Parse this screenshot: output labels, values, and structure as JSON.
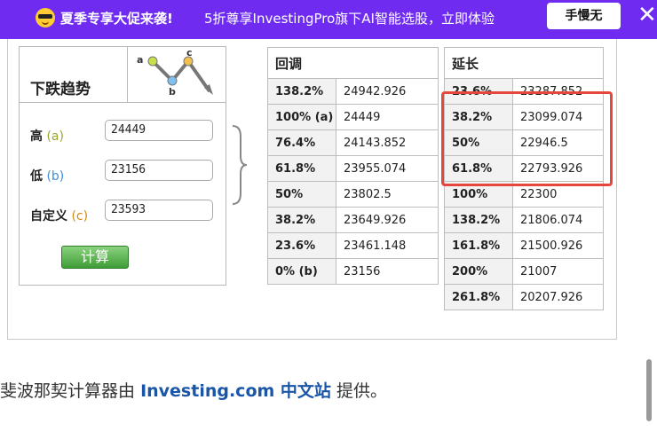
{
  "banner": {
    "icon": "sunglasses-emoji-icon",
    "promo": "夏季专享大促来袭!",
    "promo_sub": "5折尊享InvestingPro旗下AI智能选股，立即体验",
    "button": "手慢无",
    "close": "✕"
  },
  "panel": {
    "title": "下跌趋势",
    "diagram_labels": {
      "a": "a",
      "b": "b",
      "c": "c"
    },
    "fields": [
      {
        "label": "高",
        "key": "(a)",
        "value": "24449"
      },
      {
        "label": "低",
        "key": "(b)",
        "value": "23156"
      },
      {
        "label": "自定义",
        "key": "(c)",
        "value": "23593"
      }
    ],
    "calc_button": "计算"
  },
  "retracement": {
    "header": "回调",
    "rows": [
      {
        "level": "138.2%",
        "value": "24942.926"
      },
      {
        "level": "100% (a)",
        "value": "24449"
      },
      {
        "level": "76.4%",
        "value": "24143.852"
      },
      {
        "level": "61.8%",
        "value": "23955.074"
      },
      {
        "level": "50%",
        "value": "23802.5"
      },
      {
        "level": "38.2%",
        "value": "23649.926"
      },
      {
        "level": "23.6%",
        "value": "23461.148"
      },
      {
        "level": "0% (b)",
        "value": "23156"
      }
    ]
  },
  "extension": {
    "header": "延长",
    "rows": [
      {
        "level": "23.6%",
        "value": "23287.852"
      },
      {
        "level": "38.2%",
        "value": "23099.074"
      },
      {
        "level": "50%",
        "value": "22946.5"
      },
      {
        "level": "61.8%",
        "value": "22793.926"
      },
      {
        "level": "100%",
        "value": "22300"
      },
      {
        "level": "138.2%",
        "value": "21806.074"
      },
      {
        "level": "161.8%",
        "value": "21500.926"
      },
      {
        "level": "200%",
        "value": "21007"
      },
      {
        "level": "261.8%",
        "value": "20207.926"
      }
    ]
  },
  "footer": {
    "prefix": "斐波那契计算器由",
    "link": "Investing.com 中文站",
    "suffix": "提供。"
  },
  "colors": {
    "banner": "#6f2cf0",
    "highlight": "#e5473f",
    "link": "#1a56a8",
    "button": "#3f9c37"
  }
}
